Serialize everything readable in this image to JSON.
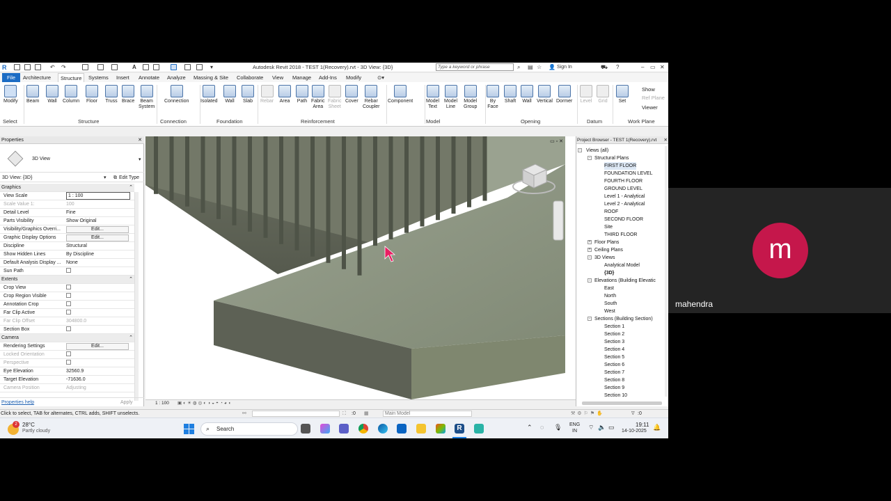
{
  "window": {
    "title": "Autodesk Revit 2018 -    TEST 1(Recovery).rvt - 3D View: {3D}",
    "search_placeholder": "Type a keyword or phrase",
    "sign_in": "Sign In",
    "app_icon": "R"
  },
  "tabs": [
    "File",
    "Architecture",
    "Structure",
    "Systems",
    "Insert",
    "Annotate",
    "Analyze",
    "Massing & Site",
    "Collaborate",
    "View",
    "Manage",
    "Add-Ins",
    "Modify"
  ],
  "active_tab": "Structure",
  "ribbon": {
    "buttons": [
      {
        "label": "Modify",
        "sel": true
      },
      {
        "label": "Beam"
      },
      {
        "label": "Wall"
      },
      {
        "label": "Column"
      },
      {
        "label": "Floor"
      },
      {
        "label": "Truss"
      },
      {
        "label": "Brace"
      },
      {
        "label": "Beam\nSystem"
      },
      {
        "label": "Connection"
      },
      {
        "label": "Isolated"
      },
      {
        "label": "Wall"
      },
      {
        "label": "Slab"
      },
      {
        "label": "Rebar",
        "dis": true
      },
      {
        "label": "Area"
      },
      {
        "label": "Path"
      },
      {
        "label": "Fabric\nArea"
      },
      {
        "label": "Fabric\nSheet",
        "dis": true
      },
      {
        "label": "Cover"
      },
      {
        "label": "Rebar\nCoupler"
      },
      {
        "label": "Component"
      },
      {
        "label": "Model\nText"
      },
      {
        "label": "Model\nLine"
      },
      {
        "label": "Model\nGroup"
      },
      {
        "label": "By\nFace"
      },
      {
        "label": "Shaft"
      },
      {
        "label": "Wall"
      },
      {
        "label": "Vertical"
      },
      {
        "label": "Dormer"
      },
      {
        "label": "Level",
        "dis": true
      },
      {
        "label": "Grid",
        "dis": true
      },
      {
        "label": "Set"
      }
    ],
    "workplane_small": [
      "Show",
      "Ref  Plane",
      "Viewer"
    ],
    "panels": [
      "Select",
      "Structure",
      "Connection",
      "Foundation",
      "Reinforcement",
      "Model",
      "Opening",
      "Datum",
      "Work Plane"
    ]
  },
  "properties": {
    "header": "Properties",
    "type_name": "3D View",
    "instance": "3D View: {3D}",
    "edit_type": "Edit Type",
    "rows": [
      {
        "k": "Graphics",
        "sect": true
      },
      {
        "k": "View Scale",
        "v": "1 : 100",
        "box": true
      },
      {
        "k": "Scale Value    1:",
        "v": "100",
        "grey": true
      },
      {
        "k": "Detail Level",
        "v": "Fine"
      },
      {
        "k": "Parts Visibility",
        "v": "Show Original"
      },
      {
        "k": "Visibility/Graphics Overri...",
        "v": "Edit...",
        "btn": true
      },
      {
        "k": "Graphic Display Options",
        "v": "Edit...",
        "btn": true
      },
      {
        "k": "Discipline",
        "v": "Structural"
      },
      {
        "k": "Show Hidden Lines",
        "v": "By Discipline"
      },
      {
        "k": "Default Analysis Display ...",
        "v": "None"
      },
      {
        "k": "Sun Path",
        "cb": true
      },
      {
        "k": "Extents",
        "sect": true
      },
      {
        "k": "Crop View",
        "cb": true
      },
      {
        "k": "Crop Region Visible",
        "cb": true
      },
      {
        "k": "Annotation Crop",
        "cb": true
      },
      {
        "k": "Far Clip Active",
        "cb": true
      },
      {
        "k": "Far Clip Offset",
        "v": "304800.0",
        "grey": true
      },
      {
        "k": "Section Box",
        "cb": true
      },
      {
        "k": "Camera",
        "sect": true
      },
      {
        "k": "Rendering Settings",
        "v": "Edit...",
        "btn": true
      },
      {
        "k": "Locked Orientation",
        "cb": true,
        "grey": true
      },
      {
        "k": "Perspective",
        "cb": true,
        "grey": true
      },
      {
        "k": "Eye Elevation",
        "v": "32560.9"
      },
      {
        "k": "Target Elevation",
        "v": "-71636.0"
      },
      {
        "k": "Camera Position",
        "v": "Adjusting",
        "grey": true
      }
    ],
    "help": "Properties help",
    "apply": "Apply"
  },
  "view": {
    "scale_label": "1 : 100"
  },
  "browser": {
    "header": "Project Browser - TEST 1(Recovery).rvt",
    "nodes": [
      {
        "t": "Views (all)",
        "lvl": 0,
        "tg": "-"
      },
      {
        "t": "Structural Plans",
        "lvl": 1,
        "tg": "-"
      },
      {
        "t": "FIRST FLOOR",
        "lvl": 2,
        "sel": true
      },
      {
        "t": "FOUNDATION LEVEL",
        "lvl": 2
      },
      {
        "t": "FOURTH FLOOR",
        "lvl": 2
      },
      {
        "t": "GROUND LEVEL",
        "lvl": 2
      },
      {
        "t": "Level 1 - Analytical",
        "lvl": 2
      },
      {
        "t": "Level 2 - Analytical",
        "lvl": 2
      },
      {
        "t": "ROOF",
        "lvl": 2
      },
      {
        "t": "SECOND FLOOR",
        "lvl": 2
      },
      {
        "t": "Site",
        "lvl": 2
      },
      {
        "t": "THIRD FLOOR",
        "lvl": 2
      },
      {
        "t": "Floor Plans",
        "lvl": 1,
        "tg": "+"
      },
      {
        "t": "Ceiling Plans",
        "lvl": 1,
        "tg": "+"
      },
      {
        "t": "3D Views",
        "lvl": 1,
        "tg": "-"
      },
      {
        "t": "Analytical Model",
        "lvl": 2
      },
      {
        "t": "{3D}",
        "lvl": 2,
        "bold": true
      },
      {
        "t": "Elevations (Building Elevatic",
        "lvl": 1,
        "tg": "-"
      },
      {
        "t": "East",
        "lvl": 2
      },
      {
        "t": "North",
        "lvl": 2
      },
      {
        "t": "South",
        "lvl": 2
      },
      {
        "t": "West",
        "lvl": 2
      },
      {
        "t": "Sections (Building Section)",
        "lvl": 1,
        "tg": "-"
      },
      {
        "t": "Section 1",
        "lvl": 2
      },
      {
        "t": "Section 2",
        "lvl": 2
      },
      {
        "t": "Section 3",
        "lvl": 2
      },
      {
        "t": "Section 4",
        "lvl": 2
      },
      {
        "t": "Section 5",
        "lvl": 2
      },
      {
        "t": "Section 6",
        "lvl": 2
      },
      {
        "t": "Section 7",
        "lvl": 2
      },
      {
        "t": "Section 8",
        "lvl": 2
      },
      {
        "t": "Section 9",
        "lvl": 2
      },
      {
        "t": "Section 10",
        "lvl": 2
      }
    ]
  },
  "status": {
    "hint": "Click to select, TAB for alternates, CTRL adds, SHIFT unselects.",
    "zero": ":0",
    "model": "Main Model",
    "filter_count": ":0"
  },
  "taskbar": {
    "temp": "28°C",
    "weather": "Partly cloudy",
    "badge": "2",
    "search": "Search",
    "lang1": "ENG",
    "lang2": "IN",
    "time": "19:11",
    "date": "14-10-2025"
  },
  "participant": {
    "initial": "m",
    "name": "mahendra"
  },
  "colors": {
    "file_tab": "#1c6cc4",
    "avatar": "#c5174b",
    "concrete": "#8d9682"
  }
}
